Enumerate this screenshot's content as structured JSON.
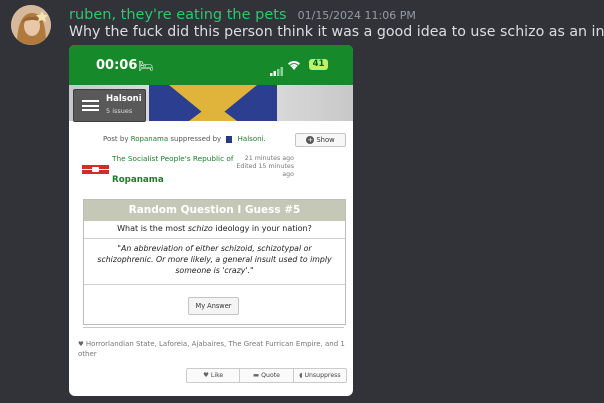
{
  "message": {
    "username": "ruben, they're eating the pets",
    "timestamp": "01/15/2024 11:06 PM",
    "text": "Why the fuck did this person think it was a good idea to use schizo as an insult"
  },
  "phone": {
    "status": {
      "time": "00:06",
      "battery": "41"
    },
    "header": {
      "nation": "Halsoni",
      "issues": "5 issues"
    },
    "post": {
      "post_by": "Post by",
      "author": "Ropanama",
      "suppressed_by": "suppressed by",
      "suppressor": "Halsoni.",
      "show_label": "Show",
      "nation_full": "The Socialist People's Republic of",
      "nation_short": "Ropanama",
      "time_ago": "21 minutes ago",
      "edited": "Edited 15 minutes ago"
    },
    "issue": {
      "title": "Random Question I Guess #5",
      "question_pre": "What is the most ",
      "question_em": "schizo",
      "question_post": " ideology in your nation?",
      "answer": "\"An abbreviation of either schizoid, schizotypal or schizophrenic. Or more likely, a general insult used to imply someone is 'crazy'.\"",
      "answer_button": "My Answer"
    },
    "likers": "Horrorlandian State, Laforeia, Ajabaires, The Great Furrican Empire, and 1 other",
    "actions": {
      "like": "Like",
      "quote": "Quote",
      "unsuppress": "Unsuppress"
    }
  }
}
